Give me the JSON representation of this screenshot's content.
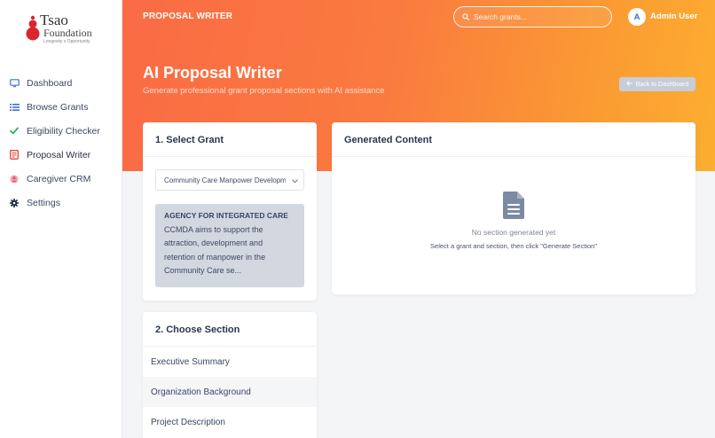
{
  "brand": {
    "name": "Tsao",
    "sub": "Foundation",
    "tagline": "Longevity x Opportunity",
    "logo_color": "#d8262e"
  },
  "header": {
    "section_title": "PROPOSAL WRITER",
    "search_placeholder": "Search grants...",
    "user_initial": "A",
    "user_name": "Admin User"
  },
  "sidebar": {
    "items": [
      {
        "label": "Dashboard",
        "icon": "monitor-icon",
        "color": "#3b6fd9"
      },
      {
        "label": "Browse Grants",
        "icon": "list-icon",
        "color": "#3b6fd9"
      },
      {
        "label": "Eligibility Checker",
        "icon": "check-icon",
        "color": "#2fae6b"
      },
      {
        "label": "Proposal Writer",
        "icon": "document-icon",
        "color": "#e24b3b",
        "active": true
      },
      {
        "label": "Caregiver CRM",
        "icon": "user-icon",
        "color": "#e86b8a"
      },
      {
        "label": "Settings",
        "icon": "gear-icon",
        "color": "#1f2b4a"
      }
    ]
  },
  "page": {
    "title": "AI Proposal Writer",
    "subtitle": "Generate professional grant proposal sections with AI assistance",
    "back_label": "Back to Dashboard"
  },
  "select_grant": {
    "title": "1. Select Grant",
    "selected": "Community Care Manpower Development Award",
    "agency": "AGENCY FOR INTEGRATED CARE",
    "description": "CCMDA aims to support the attraction, development and retention of manpower in the Community Care se..."
  },
  "generated": {
    "title": "Generated Content",
    "empty_title": "No section generated yet",
    "empty_sub": "Select a grant and section, then click \"Generate Section\""
  },
  "choose_section": {
    "title": "2. Choose Section",
    "items": [
      "Executive Summary",
      "Organization Background",
      "Project Description"
    ]
  },
  "colors": {
    "gradient_start": "#fa6b45",
    "gradient_end": "#fcae30",
    "accent": "#4a66c9"
  }
}
